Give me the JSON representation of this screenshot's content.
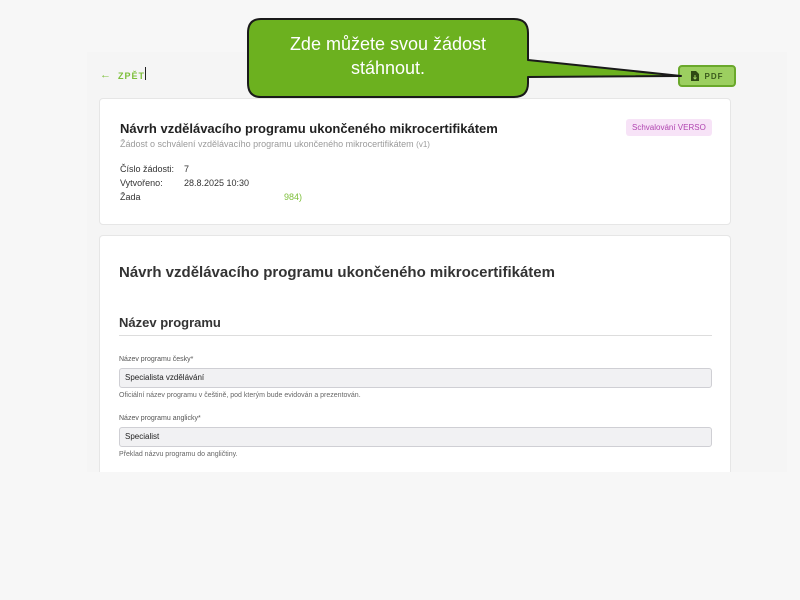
{
  "topbar": {
    "back_label": "ZPĚT",
    "pdf_label": "PDF"
  },
  "callout": {
    "line1": "Zde můžete svou žádost",
    "line2": "stáhnout."
  },
  "request": {
    "title": "Návrh vzdělávacího programu ukončeného mikrocertifikátem",
    "subtitle": "Žádost o schválení vzdělávacího programu ukončeného mikrocertifikátem",
    "version": "(v1)",
    "status": "Schvalování VERSO",
    "number_label": "Číslo žádosti:",
    "number_value": "7",
    "created_label": "Vytvořeno:",
    "created_value": "28.8.2025 10:30",
    "applicant_label": "Žada",
    "applicant_value": "984)"
  },
  "form": {
    "title": "Návrh vzdělávacího programu ukončeného mikrocertifikátem",
    "section_title": "Název programu",
    "fields": [
      {
        "label": "Název programu česky*",
        "value": "Specialista vzdělávání",
        "help": "Oficiální název programu v češtině, pod kterým bude evidován a prezentován."
      },
      {
        "label": "Název programu anglicky*",
        "value": "Specialist",
        "help": "Překlad názvu programu do angličtiny."
      }
    ]
  },
  "colors": {
    "accent": "#7dbf3a",
    "callout_fill": "#6cb11f",
    "badge_bg": "#f7e3f7",
    "badge_text": "#b045b0"
  }
}
